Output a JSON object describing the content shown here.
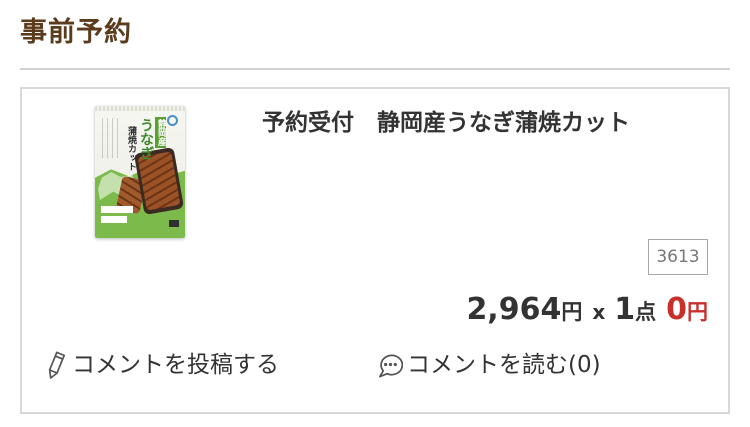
{
  "section": {
    "title": "事前予約"
  },
  "product": {
    "title": "予約受付　静岡産うなぎ蒲焼カット",
    "code": "3613",
    "image": {
      "package_origin": "静岡産",
      "package_name": "うなぎ",
      "package_subtitle": "蒲焼カット"
    },
    "price": {
      "unit_price": "2,964",
      "unit_price_currency": "円",
      "multiply": "x",
      "quantity": "1",
      "quantity_unit": "点",
      "subtotal": "0",
      "subtotal_currency": "円"
    }
  },
  "actions": {
    "post_comment": {
      "label": "コメントを投稿する",
      "icon": "pencil-icon"
    },
    "read_comments": {
      "label": "コメントを読む(0)",
      "icon": "speech-bubble-icon"
    }
  },
  "colors": {
    "section_title": "#5a3b1c",
    "text": "#333333",
    "subtotal": "#c9302c",
    "border": "#d8d8d8",
    "code_text": "#777777",
    "package_green": "#7cbb4b"
  }
}
